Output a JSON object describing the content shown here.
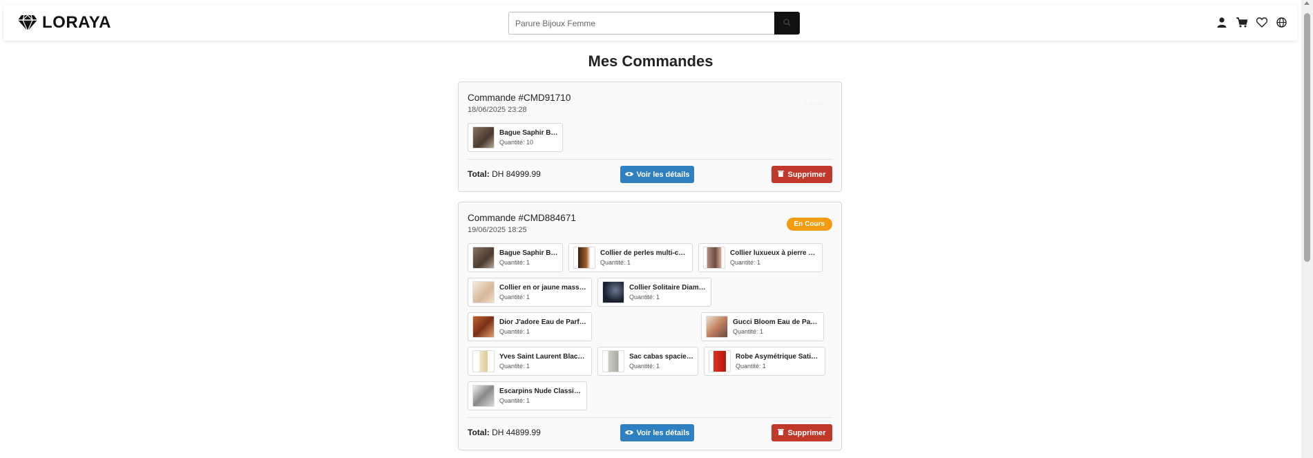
{
  "header": {
    "brand": "LORAYA",
    "search_placeholder": "Parure Bijoux Femme"
  },
  "page_title": "Mes Commandes",
  "orders": [
    {
      "title": "Commande #CMD91710",
      "date": "18/06/2025 23:28",
      "status": "Livrée",
      "items": [
        {
          "name": "Bague Saphir Bleu",
          "qty": "Quantité: 10"
        }
      ],
      "total_label": "Total:",
      "total_value": "DH 84999.99",
      "view_label": "Voir les détails",
      "delete_label": "Supprimer"
    },
    {
      "title": "Commande #CMD884671",
      "date": "19/06/2025 18:25",
      "status": "En Cours",
      "items": [
        {
          "name": "Bague Saphir Bleu",
          "qty": "Quantité: 1"
        },
        {
          "name": "Collier de perles multi-co...",
          "qty": "Quantité: 1"
        },
        {
          "name": "Collier luxueux à pierre d'...",
          "qty": "Quantité: 1"
        },
        {
          "name": "Collier en or jaune massif...",
          "qty": "Quantité: 1"
        },
        {
          "name": "Collier Solitaire Diamant",
          "qty": "Quantité: 1"
        },
        {
          "name": "Dior J'adore Eau de Parfum",
          "qty": "Quantité: 1"
        },
        {
          "name": "Gucci Bloom Eau de Parfu...",
          "qty": "Quantité: 1"
        },
        {
          "name": "Yves Saint Laurent Black ...",
          "qty": "Quantité: 1"
        },
        {
          "name": "Sac cabas spacieux",
          "qty": "Quantité: 1"
        },
        {
          "name": "Robe Asymétrique Satinée",
          "qty": "Quantité: 1"
        },
        {
          "name": "Escarpins Nude Classiques",
          "qty": "Quantité: 1"
        }
      ],
      "total_label": "Total:",
      "total_value": "DH 44899.99",
      "view_label": "Voir les détails",
      "delete_label": "Supprimer"
    }
  ],
  "colors": {
    "accent_blue": "#2f80c0",
    "danger_red": "#c0392b",
    "status_orange": "#f39c12",
    "search_button": "#111111"
  }
}
